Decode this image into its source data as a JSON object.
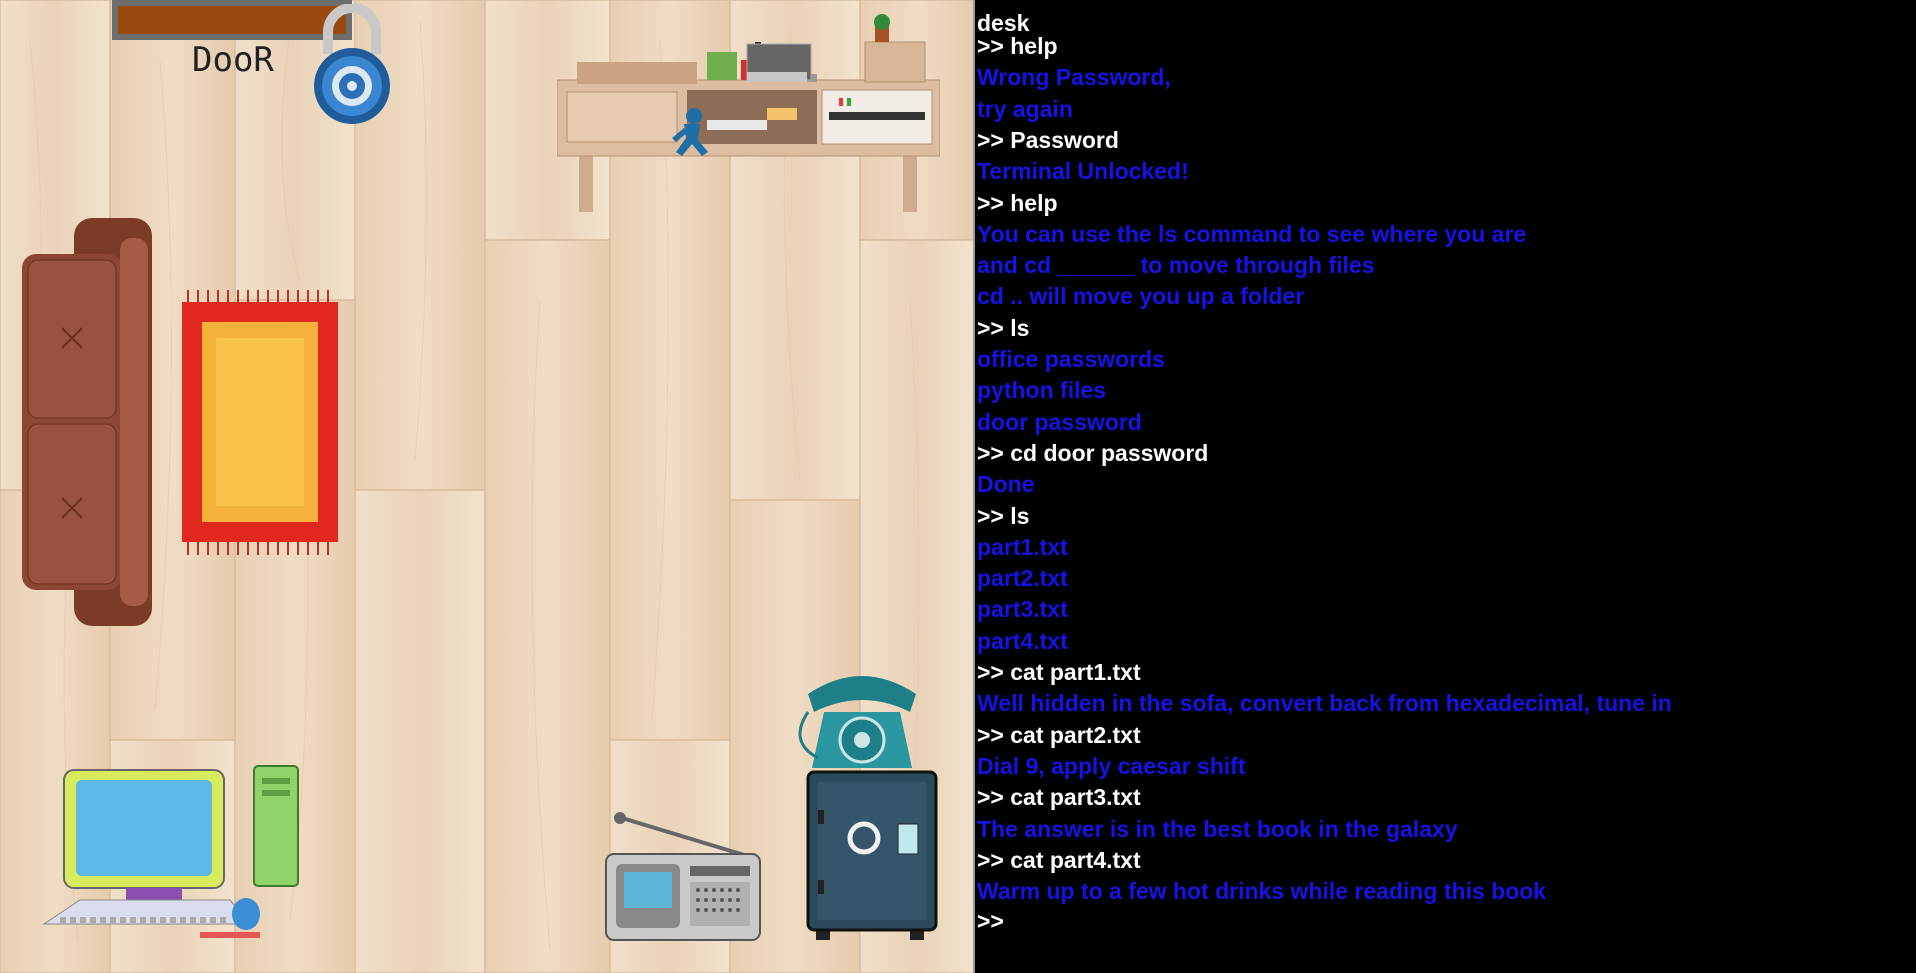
{
  "room": {
    "door_label": "DooR",
    "objects": [
      {
        "name": "door",
        "interactable": true
      },
      {
        "name": "padlock-icon",
        "interactable": true
      },
      {
        "name": "desk",
        "interactable": true
      },
      {
        "name": "player-character",
        "interactable": false
      },
      {
        "name": "sofa",
        "interactable": true
      },
      {
        "name": "rug",
        "interactable": true
      },
      {
        "name": "computer",
        "interactable": true
      },
      {
        "name": "radio",
        "interactable": true
      },
      {
        "name": "telephone",
        "interactable": true
      },
      {
        "name": "safe",
        "interactable": true
      }
    ]
  },
  "terminal": {
    "location": "desk",
    "prompt": ">>",
    "lines": [
      {
        "type": "cmd",
        "text": ">> help"
      },
      {
        "type": "out",
        "text": "Wrong Password,"
      },
      {
        "type": "out",
        "text": "try again"
      },
      {
        "type": "cmd",
        "text": ">> Password"
      },
      {
        "type": "out",
        "text": "Terminal Unlocked!"
      },
      {
        "type": "cmd",
        "text": ">> help"
      },
      {
        "type": "out",
        "text": "You can use the ls command to see where you are"
      },
      {
        "type": "out",
        "text": "and cd ______ to move through files"
      },
      {
        "type": "out",
        "text": "cd .. will move you up a folder"
      },
      {
        "type": "cmd",
        "text": ">> ls"
      },
      {
        "type": "out",
        "text": "office passwords"
      },
      {
        "type": "out",
        "text": "python files"
      },
      {
        "type": "out",
        "text": "door password"
      },
      {
        "type": "cmd",
        "text": ">> cd door password"
      },
      {
        "type": "out",
        "text": "Done"
      },
      {
        "type": "cmd",
        "text": ">> ls"
      },
      {
        "type": "out",
        "text": "part1.txt"
      },
      {
        "type": "out",
        "text": "part2.txt"
      },
      {
        "type": "out",
        "text": "part3.txt"
      },
      {
        "type": "out",
        "text": "part4.txt"
      },
      {
        "type": "cmd",
        "text": ">> cat part1.txt"
      },
      {
        "type": "out",
        "text": "Well hidden in the sofa, convert back from hexadecimal, tune in"
      },
      {
        "type": "cmd",
        "text": ">> cat part2.txt"
      },
      {
        "type": "out",
        "text": "Dial 9, apply caesar shift"
      },
      {
        "type": "cmd",
        "text": ">> cat part3.txt"
      },
      {
        "type": "out",
        "text": "The answer is in the best book in the galaxy"
      },
      {
        "type": "cmd",
        "text": ">> cat part4.txt"
      },
      {
        "type": "out",
        "text": "Warm up to a few hot drinks while reading this book"
      }
    ]
  },
  "colors": {
    "command_text": "#ffffff",
    "output_text": "#1414e6",
    "terminal_bg": "#000000",
    "floor": "#ecd6bd"
  }
}
